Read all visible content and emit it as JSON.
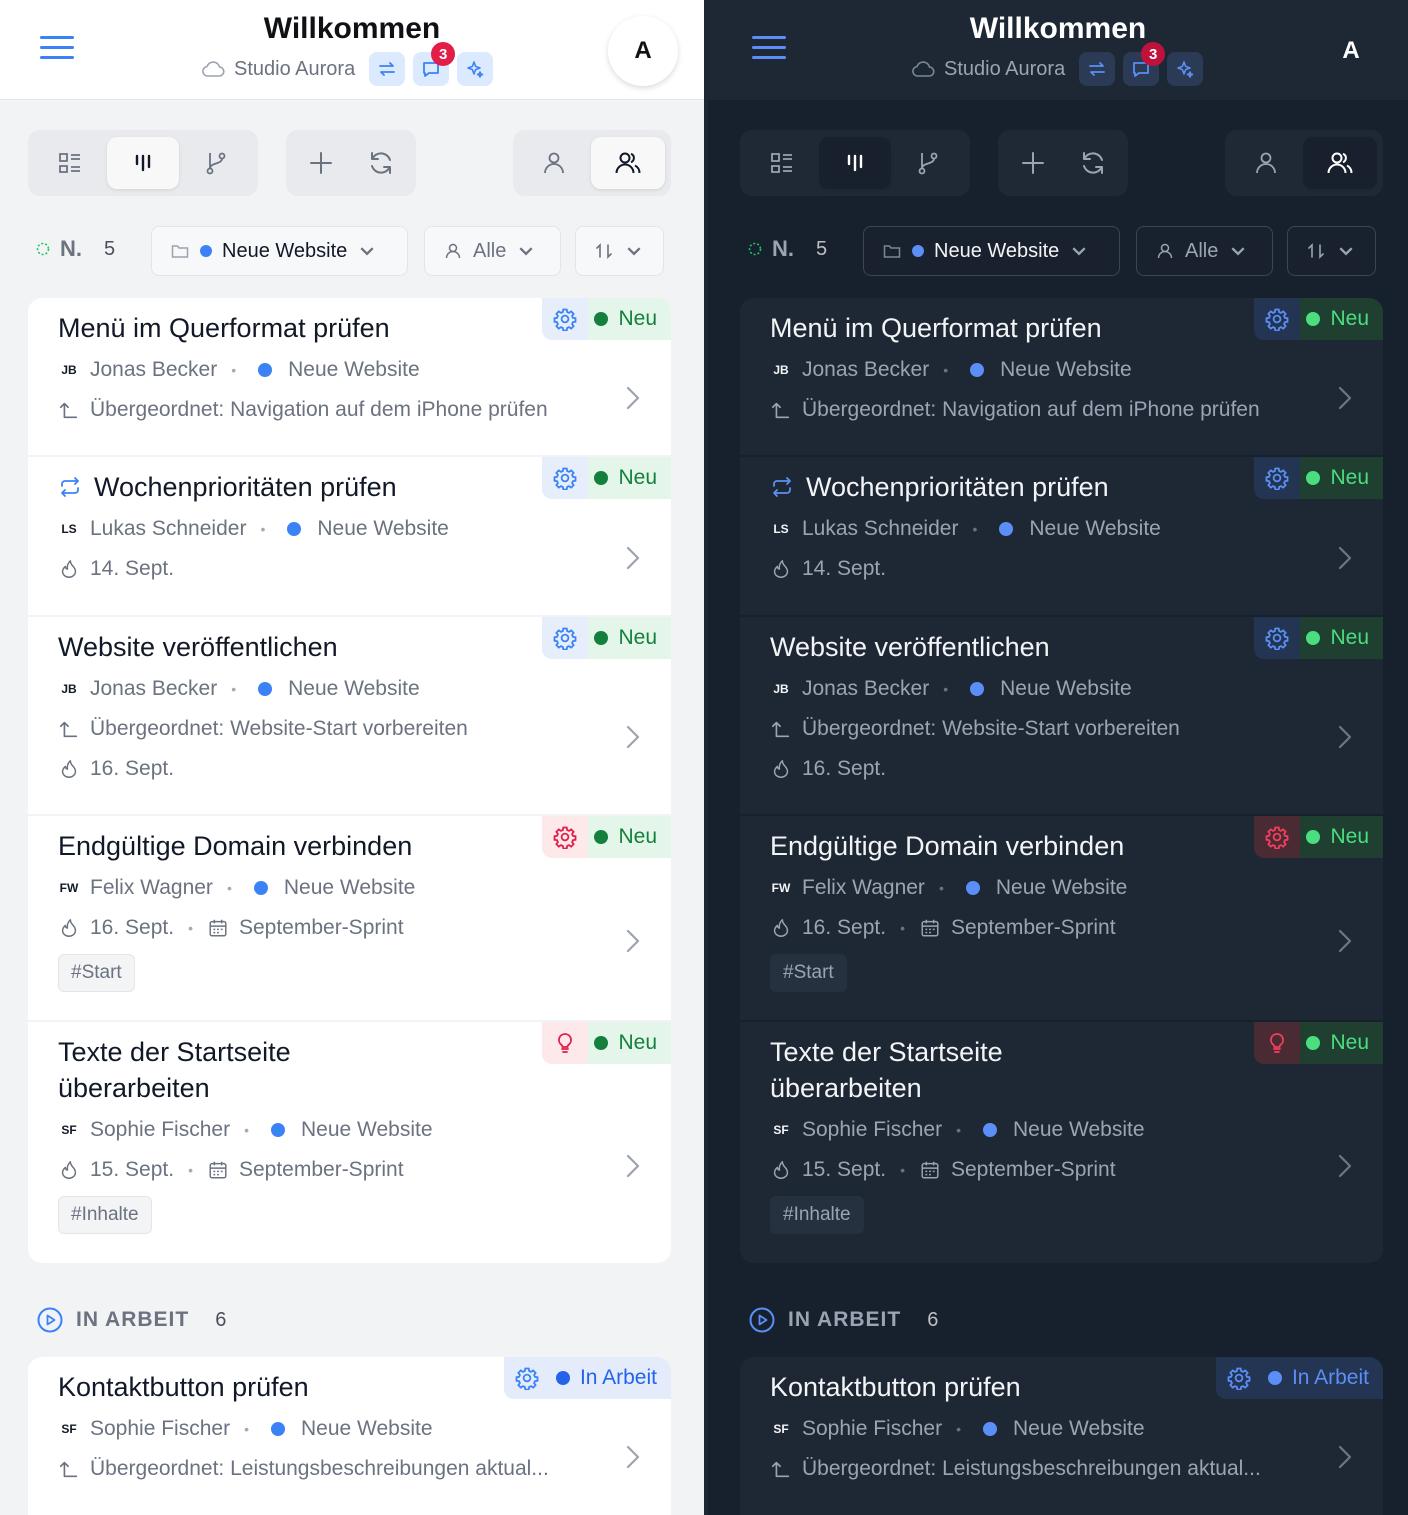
{
  "header": {
    "title": "Willkommen",
    "workspace": "Studio Aurora",
    "notifications_count": "3",
    "avatar_initial": "A"
  },
  "filters": {
    "status_label": "N.",
    "status_count": "5",
    "project_chip": "Neue Website",
    "assignee_chip": "Alle"
  },
  "section_new": {
    "cards": [
      {
        "title": "Menü im Querformat prüfen",
        "initials": "JB",
        "person": "Jonas Becker",
        "project": "Neue Website",
        "parent": "Übergeordnet: Navigation auf dem iPhone prüfen",
        "status": "Neu"
      },
      {
        "title": "Wochenprioritäten prüfen",
        "initials": "LS",
        "person": "Lukas Schneider",
        "project": "Neue Website",
        "date": "14. Sept.",
        "status": "Neu"
      },
      {
        "title": "Website veröffentlichen",
        "initials": "JB",
        "person": "Jonas Becker",
        "project": "Neue Website",
        "parent": "Übergeordnet: Website-Start vorbereiten",
        "date": "16. Sept.",
        "status": "Neu"
      },
      {
        "title": "Endgültige Domain verbinden",
        "initials": "FW",
        "person": "Felix Wagner",
        "project": "Neue Website",
        "date": "16. Sept.",
        "sprint": "September-Sprint",
        "tag": "#Start",
        "status": "Neu"
      },
      {
        "title": "Texte der Startseite überarbeiten",
        "title_line1": "Texte der Startseite",
        "title_line2": "überarbeiten",
        "initials": "SF",
        "person": "Sophie Fischer",
        "project": "Neue Website",
        "date": "15. Sept.",
        "sprint": "September-Sprint",
        "tag": "#Inhalte",
        "status": "Neu"
      }
    ]
  },
  "section_progress": {
    "label": "IN ARBEIT",
    "count": "6",
    "cards": [
      {
        "title": "Kontaktbutton prüfen",
        "initials": "SF",
        "person": "Sophie Fischer",
        "project": "Neue Website",
        "parent": "Übergeordnet: Leistungsbeschreibungen aktual...",
        "status": "In Arbeit"
      }
    ]
  },
  "colors": {
    "accent_light": "#3b82f6",
    "accent_dark": "#5b8ff7",
    "status_new": "#15803d",
    "badge": "#e11d48"
  },
  "icons": [
    "menu-icon",
    "cloud-icon",
    "swap-icon",
    "chat-icon",
    "sparkle-icon",
    "list-view-icon",
    "kanban-view-icon",
    "branch-view-icon",
    "plus-icon",
    "refresh-icon",
    "user-icon",
    "users-icon",
    "folder-icon",
    "sort-icon",
    "gear-icon",
    "bulb-icon",
    "parent-arrow-icon",
    "flame-icon",
    "calendar-icon",
    "chevron-right-icon",
    "play-circle-icon",
    "repeat-icon"
  ]
}
